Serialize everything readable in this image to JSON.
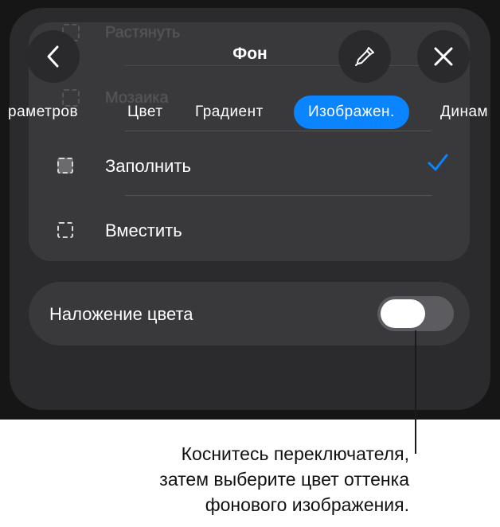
{
  "header": {
    "title": "Фон",
    "back_icon": "chevron-left-icon",
    "eyedropper_icon": "eyedropper-icon",
    "close_icon": "close-icon"
  },
  "background_items": {
    "stretch": "Растянуть",
    "tile": "Мозаика"
  },
  "tabs": [
    {
      "label": "раметров",
      "active": false
    },
    {
      "label": "Цвет",
      "active": false
    },
    {
      "label": "Градиент",
      "active": false
    },
    {
      "label": "Изображен.",
      "active": true
    },
    {
      "label": "Динам",
      "active": false
    }
  ],
  "options": [
    {
      "label": "Заполнить",
      "selected": true
    },
    {
      "label": "Вместить",
      "selected": false
    }
  ],
  "color_overlay": {
    "label": "Наложение цвета",
    "enabled": false
  },
  "callout": {
    "line1": "Коснитесь переключателя,",
    "line2": "затем выберите цвет оттенка",
    "line3": "фонового изображения."
  },
  "colors": {
    "accent": "#0a84ff",
    "sheet": "#2b2b2d",
    "card": "#39393b"
  }
}
